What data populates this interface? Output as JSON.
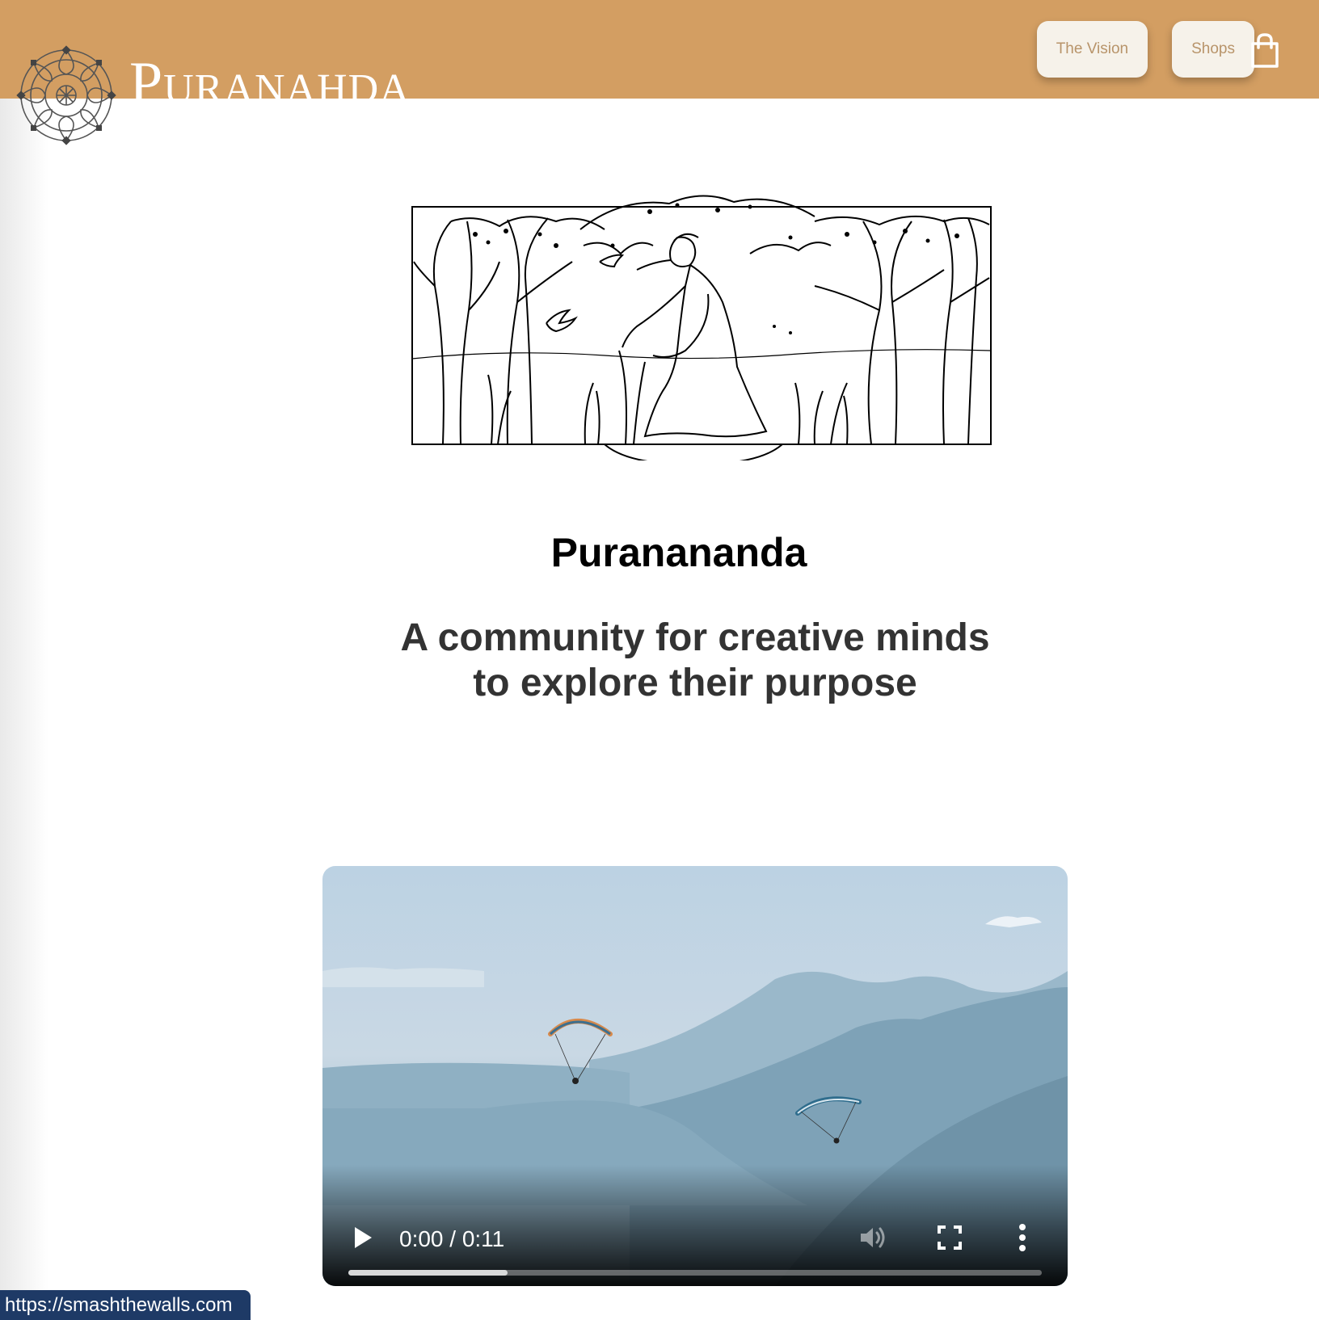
{
  "header": {
    "brand_name": "Puranahda",
    "nav": [
      {
        "label": "The Vision"
      },
      {
        "label": "Shops"
      }
    ],
    "cart_icon": "shopping-bag-icon",
    "background_color": "#d39e62"
  },
  "hero": {
    "title": "Puranananda",
    "tagline_line1": "A community for creative minds",
    "tagline_line2": "to explore their purpose"
  },
  "video": {
    "time": "0:00 / 0:11",
    "buffered_fraction": 0.23,
    "icons": [
      "play-icon",
      "volume-icon",
      "fullscreen-icon",
      "more-options-icon"
    ]
  },
  "status_bar": {
    "url": "https://smashthewalls.com"
  }
}
